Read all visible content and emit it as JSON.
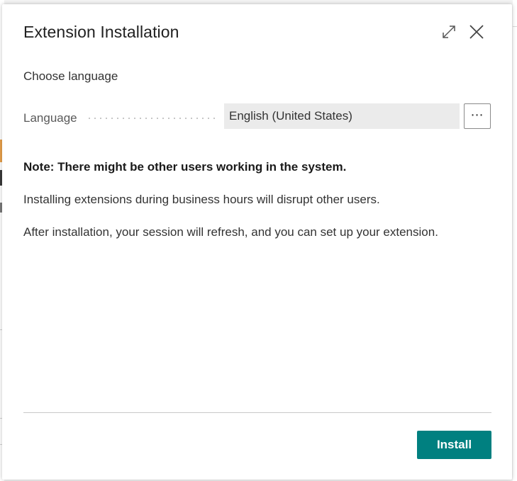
{
  "dialog": {
    "title": "Extension Installation",
    "expand_icon": "expand-diagonal-icon",
    "close_icon": "close-icon"
  },
  "language_section": {
    "heading": "Choose language",
    "field_label": "Language",
    "field_value": "English (United States)",
    "lookup_label": "⋯"
  },
  "notes": {
    "warning": "Note: There might be other users working in the system.",
    "line1": "Installing extensions during business hours will disrupt other users.",
    "line2": "After installation, your session will refresh, and you can set up your extension."
  },
  "footer": {
    "install_label": "Install"
  },
  "colors": {
    "primary_button": "#008080",
    "field_background": "#ebebeb"
  }
}
